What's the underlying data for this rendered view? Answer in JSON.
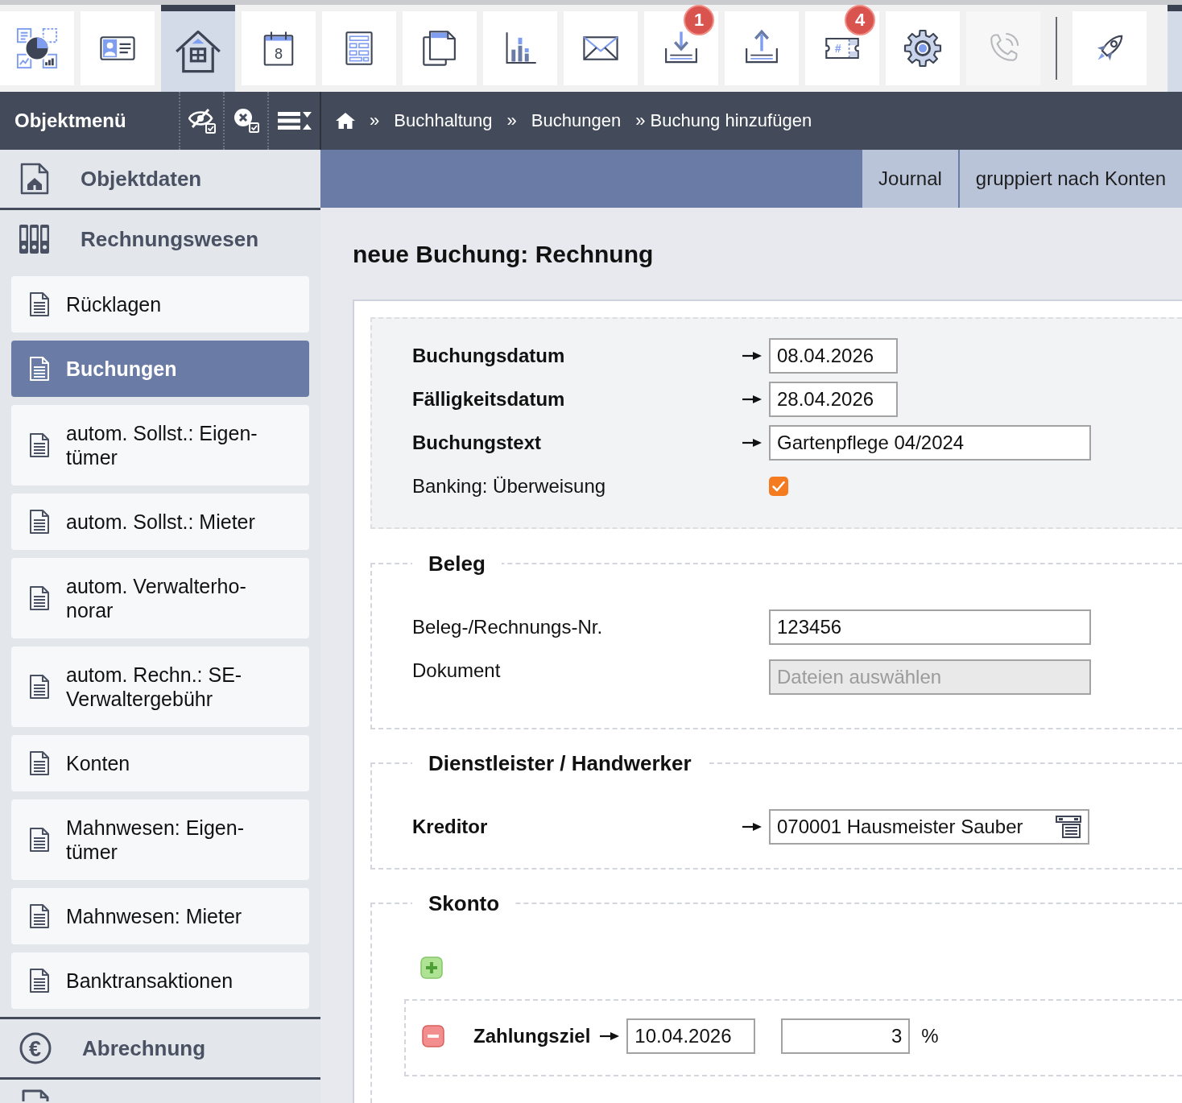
{
  "toolbar": {
    "main": [
      {
        "selected": false,
        "disabled": false
      },
      {
        "selected": false,
        "disabled": false
      },
      {
        "selected": true,
        "disabled": false
      },
      {
        "selected": false,
        "disabled": false,
        "icon_text": "8"
      },
      {
        "selected": false,
        "disabled": false
      },
      {
        "selected": false,
        "disabled": false
      },
      {
        "selected": false,
        "disabled": false
      },
      {
        "selected": false,
        "disabled": false
      },
      {
        "selected": false,
        "disabled": false,
        "badge": "1"
      },
      {
        "selected": false,
        "disabled": false
      },
      {
        "selected": false,
        "disabled": false,
        "badge": "4",
        "icon_text": "#"
      },
      {
        "selected": false,
        "disabled": false
      },
      {
        "selected": false,
        "disabled": true
      }
    ],
    "extra": [
      {
        "selected": false,
        "disabled": false
      },
      {
        "selected": true,
        "disabled": false
      }
    ]
  },
  "header": {
    "title": "Objektmenü",
    "breadcrumb": [
      {
        "separator": "»",
        "label": "Buchhaltung"
      },
      {
        "separator": "»",
        "label": "Buchungen"
      },
      {
        "label": "» Buchung hinzufügen"
      }
    ]
  },
  "sidebar": {
    "sections": [
      {
        "label": "Objektdaten",
        "expanded": false
      },
      {
        "label": "Rechnungswesen",
        "expanded": true,
        "children": [
          {
            "label": "Rücklagen",
            "selected": false
          },
          {
            "label": "Buchungen",
            "selected": true
          },
          {
            "label": "autom. Sollst.: Eigen-tümer",
            "selected": false
          },
          {
            "label": "autom. Sollst.: Mieter",
            "selected": false
          },
          {
            "label": "autom. Verwalterho-norar",
            "selected": false
          },
          {
            "label": "autom. Rechn.: SE-Verwaltergebühr",
            "selected": false
          },
          {
            "label": "Konten",
            "selected": false
          },
          {
            "label": "Mahnwesen: Eigen-tümer",
            "selected": false
          },
          {
            "label": "Mahnwesen: Mieter",
            "selected": false
          },
          {
            "label": "Banktransaktionen",
            "selected": false
          }
        ]
      },
      {
        "label": "Abrechnung",
        "expanded": false,
        "icon_text": "€"
      }
    ]
  },
  "main": {
    "tabs": [
      {
        "label": "Journal",
        "selected": false
      },
      {
        "label": "gruppiert nach Konten",
        "selected": false
      }
    ],
    "title": "neue Buchung: Rechnung",
    "form": {
      "fields": [
        {
          "kind": "date",
          "label": "Buchungsdatum",
          "required": true,
          "value": "08.04.2026"
        },
        {
          "kind": "date",
          "label": "Fälligkeitsdatum",
          "required": true,
          "value": "28.04.2026"
        },
        {
          "kind": "text",
          "label": "Buchungstext",
          "required": true,
          "value": "Gartenpflege 04/2024"
        },
        {
          "kind": "checkbox",
          "label": "Banking: Überweisung",
          "required": false,
          "checked": true
        }
      ],
      "sections": [
        {
          "kind": "fields",
          "legend": "Beleg",
          "fields": [
            {
              "kind": "text",
              "label": "Beleg-/Rechnungs-Nr.",
              "required": false,
              "value": "123456"
            },
            {
              "kind": "file",
              "label": "Dokument",
              "required": false,
              "disabled": true,
              "placeholder": "Dateien auswählen"
            }
          ]
        },
        {
          "kind": "fields",
          "legend": "Dienstleister / Handwerker",
          "fields": [
            {
              "kind": "lookup",
              "label": "Kreditor",
              "required": true,
              "value": "070001 Hausmeister Sauber"
            }
          ]
        },
        {
          "kind": "terms",
          "legend": "Skonto",
          "rows": [
            {
              "label": "Zahlungsziel",
              "required": true,
              "date": "10.04.2026",
              "percent": "3",
              "unit": "%"
            }
          ]
        }
      ]
    }
  }
}
